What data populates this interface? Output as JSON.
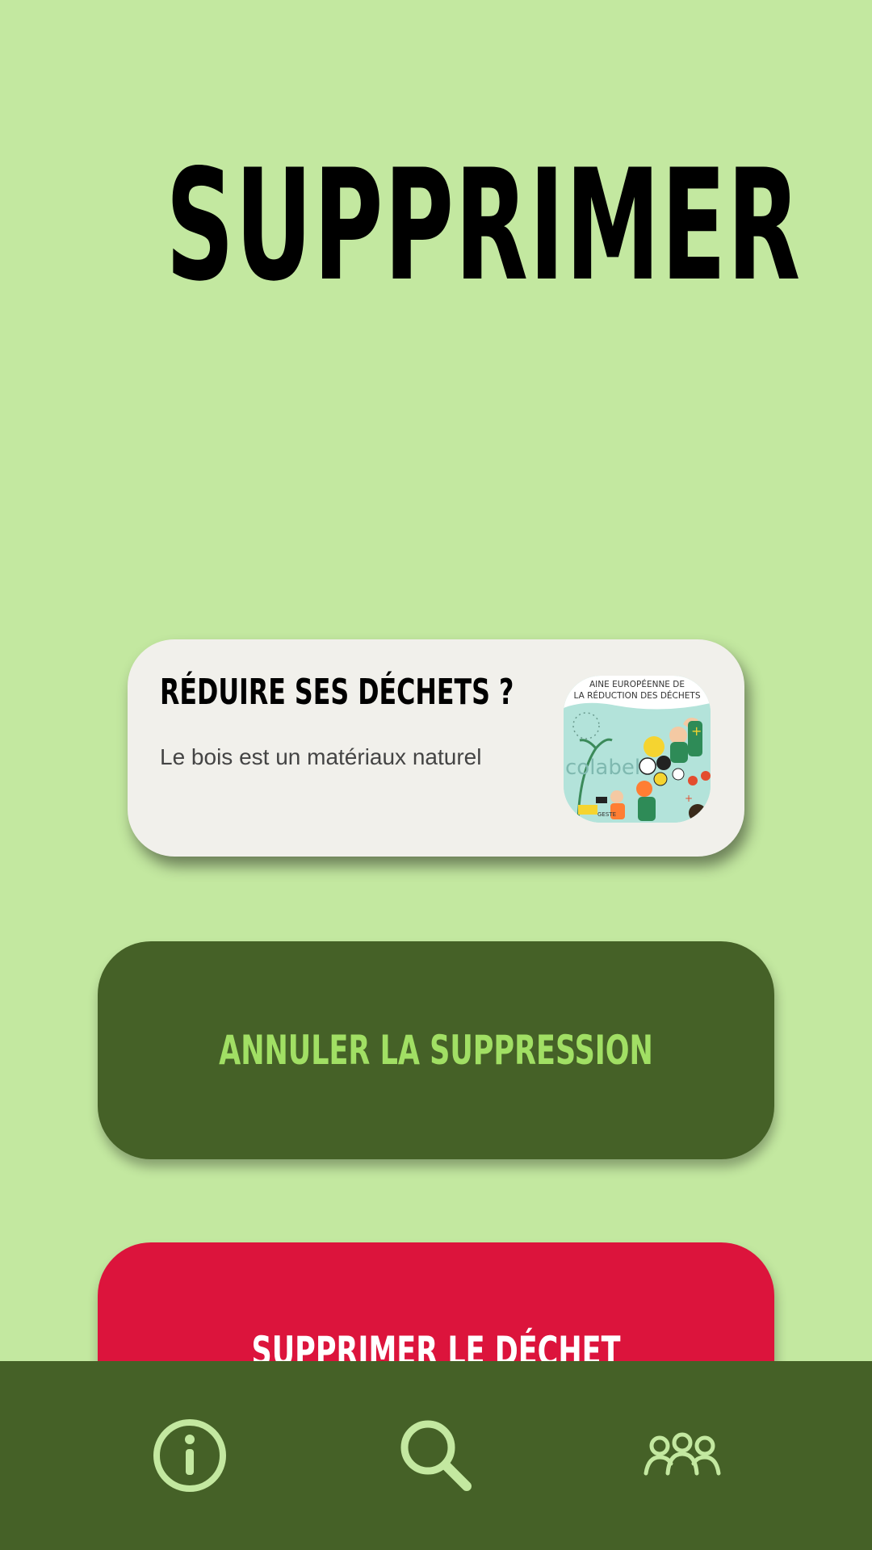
{
  "page": {
    "title": "SUPPRIMER"
  },
  "tip_card": {
    "title": "RÉDUIRE SES DÉCHETS ?",
    "text": "Le bois est un matériaux naturel",
    "image_icon": "waste-reduction-illustration",
    "image_caption": "AINE EUROPÉENNE DE LA RÉDUCTION DES DÉCHETS"
  },
  "actions": {
    "cancel_label": "ANNULER LA SUPPRESSION",
    "delete_label": "SUPPRIMER LE DÉCHET"
  },
  "bottom_nav": {
    "items": [
      {
        "icon": "info-icon"
      },
      {
        "icon": "search-icon"
      },
      {
        "icon": "group-icon"
      }
    ]
  },
  "colors": {
    "background": "#c3e8a0",
    "dark_green": "#456127",
    "light_green_text": "#a1df64",
    "danger_red": "#dc143c",
    "nav_icon": "#c3e8a0",
    "card": "#f1f0eb"
  }
}
